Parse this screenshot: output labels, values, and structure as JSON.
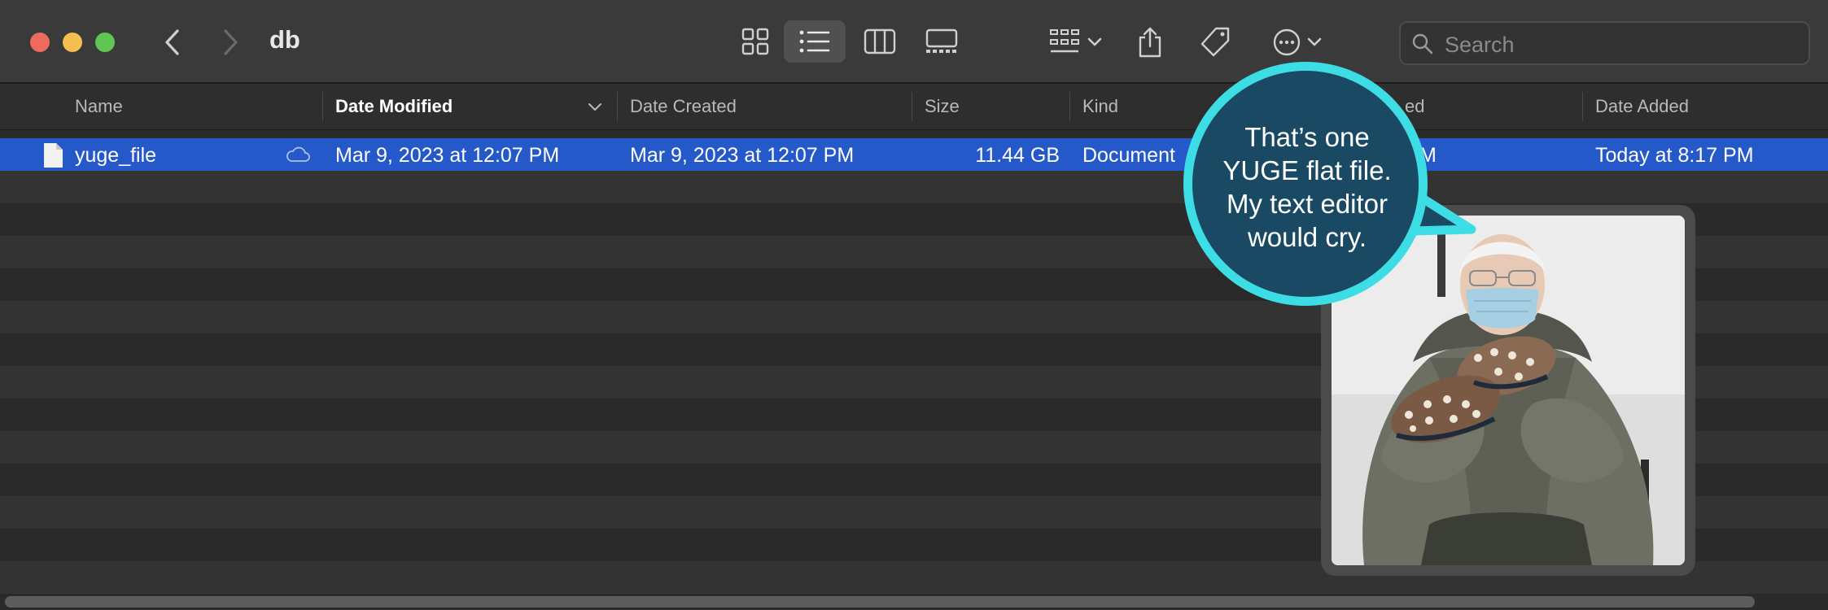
{
  "window": {
    "title": "db"
  },
  "search": {
    "placeholder": "Search",
    "value": ""
  },
  "columns": {
    "name": "Name",
    "date_modified": "Date Modified",
    "date_created": "Date Created",
    "size": "Size",
    "kind": "Kind",
    "date_last_opened_partial": "ed",
    "date_added": "Date Added"
  },
  "files": [
    {
      "name": "yuge_file",
      "date_modified": "Mar 9, 2023 at 12:07 PM",
      "date_created": "Mar 9, 2023 at 12:07 PM",
      "size": "11.44 GB",
      "kind": "Document",
      "date_last_opened_partial": "M",
      "date_added": "Today at 8:17 PM",
      "icloud": true,
      "selected": true
    }
  ],
  "meme": {
    "caption_lines": [
      "That’s one",
      "YUGE flat file.",
      "My text editor",
      "would cry."
    ],
    "bubble_fill": "#1a4a63",
    "bubble_border": "#3ddde6"
  },
  "colors": {
    "selection": "#2558c9",
    "close": "#ec6a5e",
    "minimize": "#f4bf4f",
    "maximize": "#61c554"
  }
}
